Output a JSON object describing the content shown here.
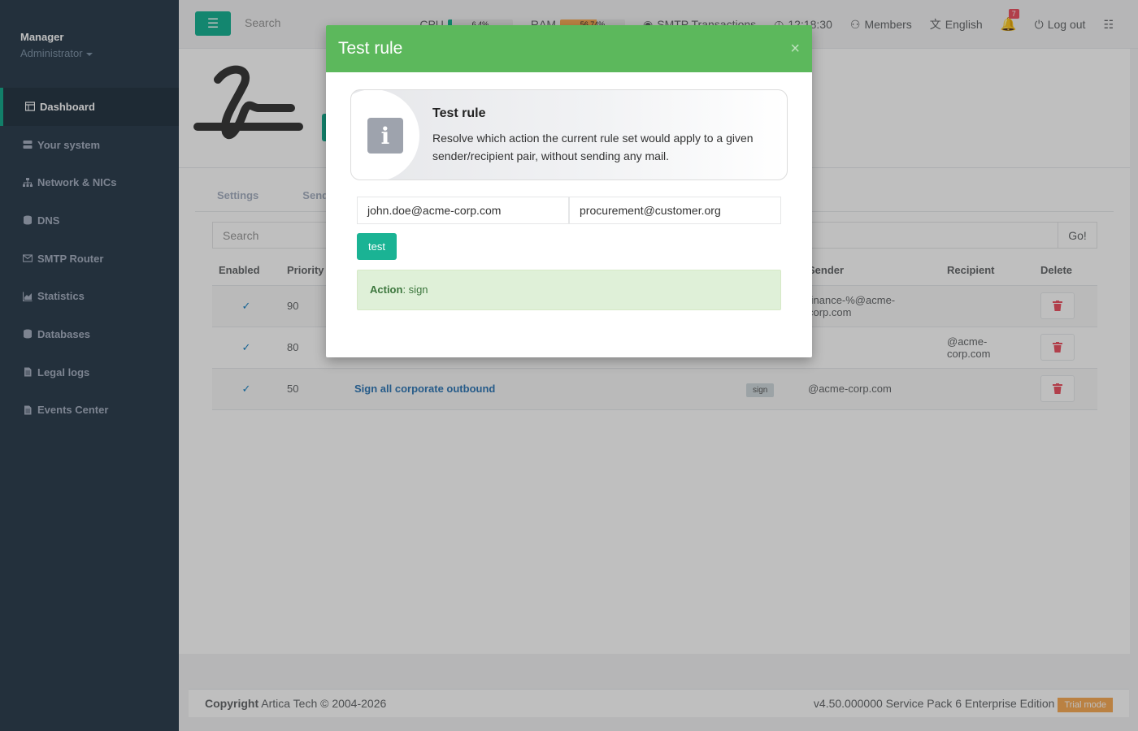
{
  "sidebar": {
    "user_name": "Manager",
    "user_role": "Administrator",
    "items": [
      {
        "label": "Dashboard",
        "icon": "table-icon"
      },
      {
        "label": "Your system",
        "icon": "server-icon"
      },
      {
        "label": "Network & NICs",
        "icon": "sitemap-icon"
      },
      {
        "label": "DNS",
        "icon": "database-icon"
      },
      {
        "label": "SMTP Router",
        "icon": "envelope-icon"
      },
      {
        "label": "Statistics",
        "icon": "chart-icon"
      },
      {
        "label": "Databases",
        "icon": "database-icon"
      },
      {
        "label": "Legal logs",
        "icon": "file-icon"
      },
      {
        "label": "Events Center",
        "icon": "file-icon"
      }
    ]
  },
  "topbar": {
    "search_placeholder": "Search",
    "cpu_label": "CPU",
    "cpu_value": "6.4%",
    "cpu_fraction": 0.064,
    "ram_label": "RAM",
    "ram_value": "56.74%",
    "ram_fraction": 0.5674,
    "smtp_label": "SMTP Transactions",
    "time": "12:18:30",
    "members_label": "Members",
    "language": "English",
    "notifications_count": "7",
    "logout_label": "Log out"
  },
  "tabs": [
    "Settings",
    "Sender"
  ],
  "table": {
    "search_placeholder": "Search",
    "go_label": "Go!",
    "headers": [
      "Enabled",
      "Priority",
      "",
      "",
      "Sender",
      "Recipient",
      "Delete"
    ],
    "rows": [
      {
        "priority": "90",
        "name": "",
        "action": "",
        "sender": "finance-%@acme-corp.com",
        "recipient": ""
      },
      {
        "priority": "80",
        "name": "",
        "action": "",
        "sender": "",
        "recipient": "@acme-corp.com"
      },
      {
        "priority": "50",
        "name": "Sign all corporate outbound",
        "action": "sign",
        "sender": "@acme-corp.com",
        "recipient": ""
      }
    ]
  },
  "footer": {
    "copyright_label": "Copyright",
    "copyright_text": "Artica Tech © 2004-2026",
    "version": "v4.50.000000 Service Pack 6 Enterprise Edition",
    "trial_label": "Trial mode"
  },
  "modal": {
    "title": "Test rule",
    "close": "×",
    "info_title": "Test rule",
    "info_text": "Resolve which action the current rule set would apply to a given sender/recipient pair, without sending any mail.",
    "sender_value": "john.doe@acme-corp.com",
    "recipient_value": "procurement@customer.org",
    "test_button": "test",
    "result_label": "Action",
    "result_value": ": sign"
  },
  "colors": {
    "accent": "#1ab394",
    "modal_header": "#5cb85c",
    "sidebar": "#2f4050",
    "danger": "#ed5565"
  }
}
